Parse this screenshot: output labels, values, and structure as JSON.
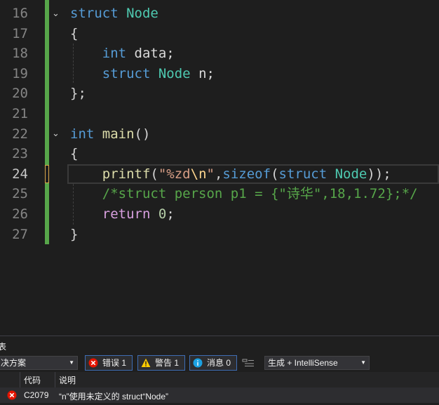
{
  "editor": {
    "line_numbers": [
      "16",
      "17",
      "18",
      "19",
      "20",
      "21",
      "22",
      "23",
      "24",
      "25",
      "26",
      "27"
    ],
    "current_line": "24",
    "colors": {
      "keyword": "#569cd6",
      "type": "#4ec9b0",
      "function": "#dcdcaa",
      "string": "#d69d85",
      "comment": "#57a64a",
      "control": "#d8a0df",
      "change_bar": "#57a64a"
    },
    "lines": {
      "l16": {
        "kw": "struct",
        "type": "Node"
      },
      "l17": {
        "brace": "{"
      },
      "l18": {
        "kw": "int",
        "rest": "data;"
      },
      "l19": {
        "kw": "struct",
        "type": "Node",
        "rest": "n;"
      },
      "l20": {
        "brace": "};"
      },
      "l22": {
        "kw": "int",
        "fn": "main",
        "rest": "()"
      },
      "l23": {
        "brace": "{"
      },
      "l24": {
        "fn": "printf",
        "open": "(",
        "str1": "\"%zd",
        "esc": "\\n",
        "str2": "\"",
        "comma": ",",
        "kw_sizeof": "sizeof",
        "open2": "(",
        "kw_struct": "struct",
        "type": "Node",
        "close": "));"
      },
      "l25": {
        "comment": "/*struct person p1 = {\"诗华\",18,1.72};*/"
      },
      "l26": {
        "ctl": "return",
        "num": "0",
        "semi": ";"
      },
      "l27": {
        "brace": "}"
      }
    }
  },
  "error_list": {
    "title": "表",
    "scope_dropdown": "决方案",
    "errors_label": "错误 1",
    "warnings_label": "警告 1",
    "messages_label": "消息 0",
    "source_dropdown": "生成 + IntelliSense",
    "columns": {
      "code": "代码",
      "description": "说明"
    },
    "rows": [
      {
        "code": "C2079",
        "description": "“n”使用未定义的 struct“Node”"
      }
    ]
  }
}
